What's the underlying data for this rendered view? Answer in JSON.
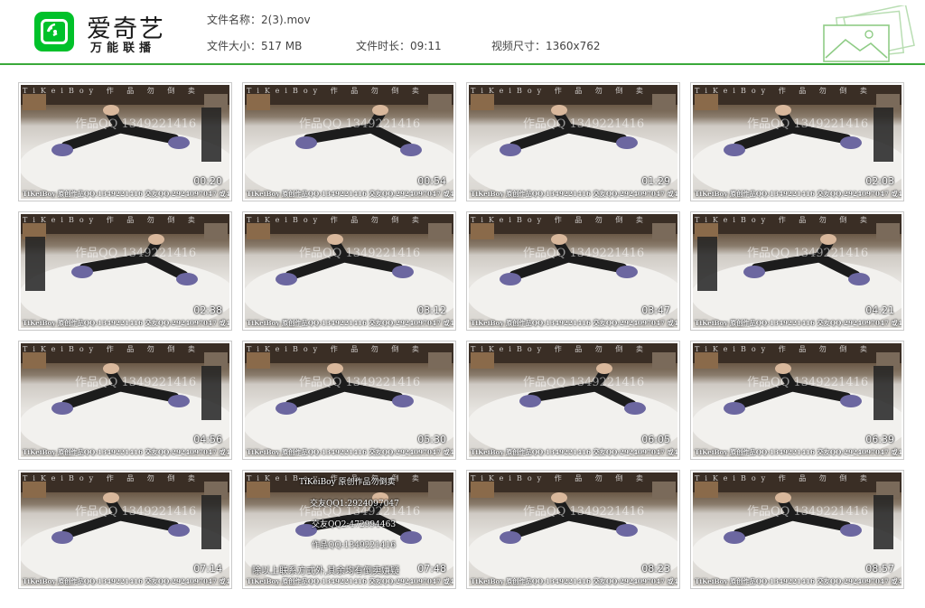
{
  "app": {
    "title": "爱奇艺",
    "subtitle": "万能联播"
  },
  "file_info": {
    "name_label": "文件名称：2(3).mov",
    "size_label": "文件大小：517 MB",
    "duration_label": "文件时长：09:11",
    "resolution_label": "视频尺寸：1360x762"
  },
  "watermark": {
    "bottom": "TiKeiBoy 原创作品QQ:1349221416 交友QQ:2924097047 或472994463",
    "top": "TiKeiBoy 作 品 勿 倒 卖",
    "middle": "作品QQ 1349221416"
  },
  "thumbnails": [
    {
      "time": "00:20"
    },
    {
      "time": "00:54"
    },
    {
      "time": "01:29"
    },
    {
      "time": "02:03"
    },
    {
      "time": "02:38"
    },
    {
      "time": "03:12"
    },
    {
      "time": "03:47"
    },
    {
      "time": "04:21"
    },
    {
      "time": "04:56"
    },
    {
      "time": "05:30"
    },
    {
      "time": "06:05"
    },
    {
      "time": "06:39"
    },
    {
      "time": "07:14"
    },
    {
      "time": "07:48"
    },
    {
      "time": "08:23"
    },
    {
      "time": "08:57"
    }
  ],
  "overlay_14": {
    "line1": "TiKeiBoy 原创作品勿倒卖",
    "line2": "交友QQ1:2924097047",
    "line3": "交友QQ2:472994463",
    "line4": "作品QQ:1349221416",
    "line5": "除以上联系方式外,其余均有倒卖嫌疑"
  },
  "colors": {
    "brand_green": "#00c12a",
    "divider_green": "#3aa93a"
  }
}
